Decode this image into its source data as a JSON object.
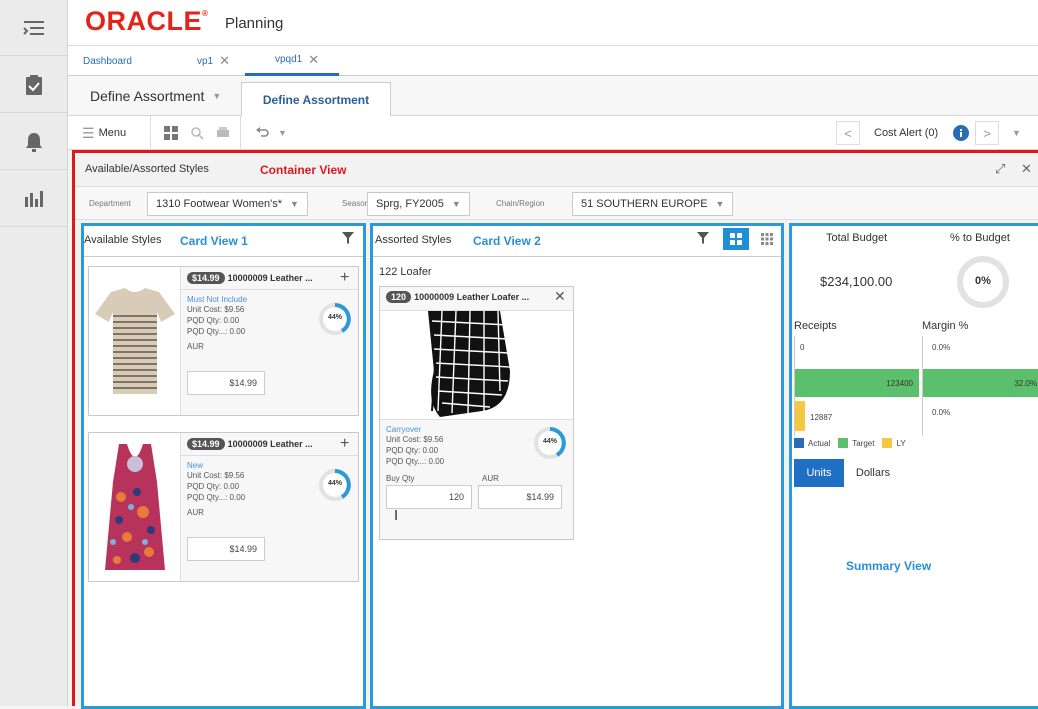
{
  "app": {
    "brand": "ORACLE",
    "product": "Planning"
  },
  "tabs": [
    {
      "label": "Dashboard"
    },
    {
      "label": "vp1"
    },
    {
      "label": "vpqd1"
    }
  ],
  "subtabs": {
    "dropdown": "Define Assortment",
    "active": "Define Assortment"
  },
  "toolbar": {
    "menu": "Menu",
    "cost_alert": "Cost Alert (0)"
  },
  "container": {
    "title": "Available/Assorted Styles",
    "annotation": "Container View",
    "filters": {
      "department_label": "Department",
      "department_value": "1310 Footwear Women's*",
      "season_label": "Season",
      "season_value": "Sprg, FY2005",
      "chain_label": "Chain/Region",
      "chain_value": "51 SOUTHERN EUROPE"
    }
  },
  "available": {
    "title": "Available Styles",
    "annotation": "Card View 1",
    "cards": [
      {
        "price": "$14.99",
        "name": "10000009 Leather ...",
        "status": "Must Not Include",
        "unit_cost": "Unit Cost: $9.56",
        "pqd_qty": "PQD Qty: 0.00",
        "pqd_qty2": "PQD Qty...: 0.00",
        "aur_label": "AUR",
        "aur": "$14.99",
        "gauge": "44%"
      },
      {
        "price": "$14.99",
        "name": "10000009 Leather ...",
        "status": "New",
        "unit_cost": "Unit Cost: $9.56",
        "pqd_qty": "PQD Qty: 0.00",
        "pqd_qty2": "PQD Qty...: 0.00",
        "aur_label": "AUR",
        "aur": "$14.99",
        "gauge": "44%"
      }
    ]
  },
  "assorted": {
    "title": "Assorted Styles",
    "annotation": "Card View 2",
    "group": "122 Loafer",
    "card": {
      "count": "120",
      "name": "10000009 Leather Loafer ...",
      "status": "Carryover",
      "unit_cost": "Unit Cost: $9.56",
      "pqd_qty": "PQD Qty: 0.00",
      "pqd_qty2": "PQD Qty...: 0.00",
      "buy_label": "Buy Qty",
      "buy": "120",
      "aur_label": "AUR",
      "aur": "$14.99",
      "gauge": "44%"
    }
  },
  "summary": {
    "total_budget_label": "Total Budget",
    "total_budget": "$234,100.00",
    "pct_label": "% to Budget",
    "pct": "0%",
    "receipts_label": "Receipts",
    "margin_label": "Margin %",
    "receipts_actual": "0",
    "receipts_target": "123400",
    "receipts_ly": "12887",
    "margin_actual": "0.0%",
    "margin_target": "32.0%",
    "margin_ly": "0.0%",
    "legend": [
      "Actual",
      "Target",
      "LY"
    ],
    "units_btn": "Units",
    "dollars_btn": "Dollars",
    "annotation": "Summary View",
    "colors": {
      "actual": "#2a6cb3",
      "target": "#5cbf6b",
      "ly": "#f5c842"
    }
  }
}
